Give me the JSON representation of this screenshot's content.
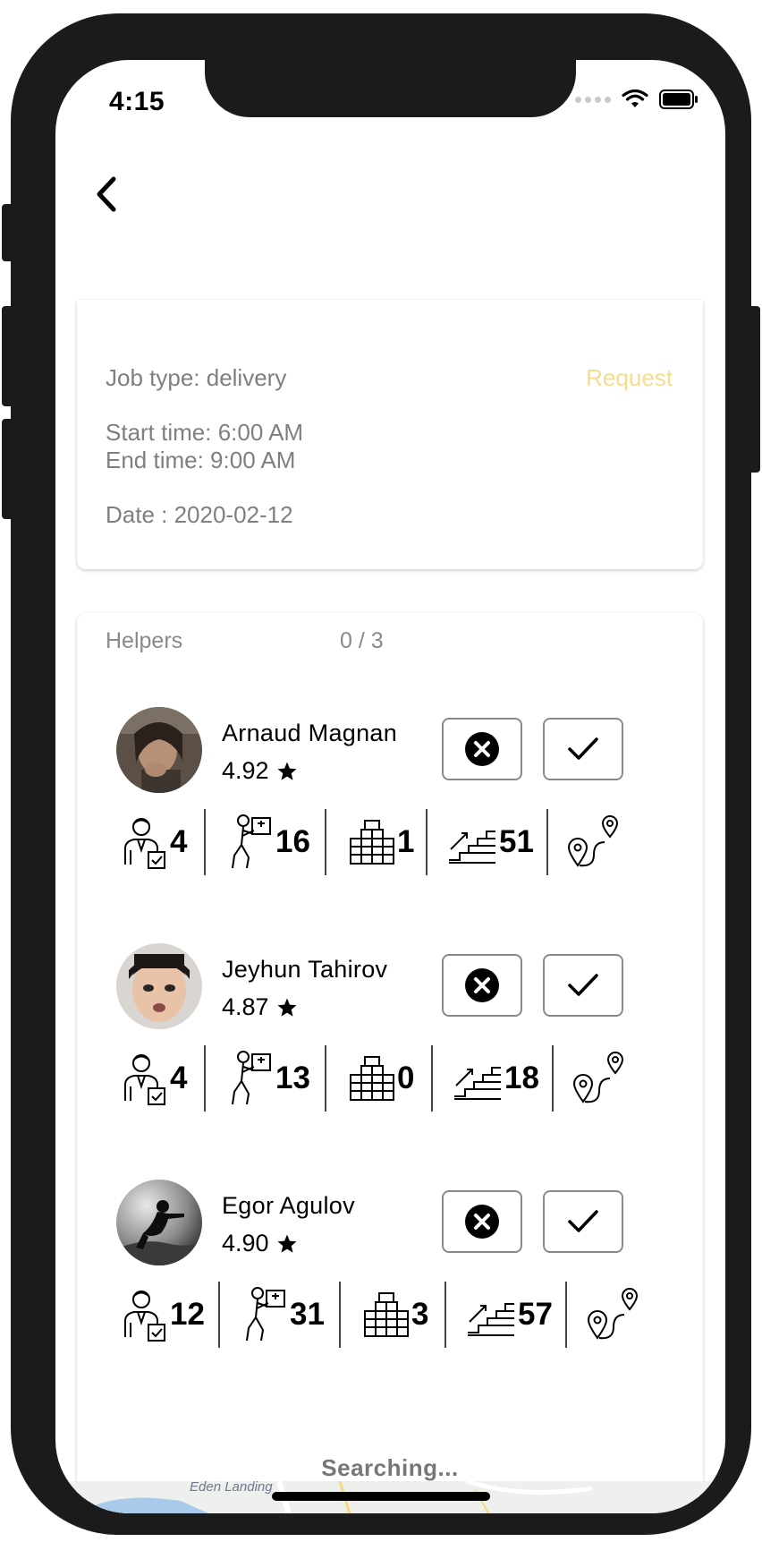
{
  "status_bar": {
    "time": "4:15"
  },
  "job": {
    "job_type": "Job type: delivery",
    "request_label": "Request",
    "start_time": "Start time: 6:00 AM",
    "end_time": "End time: 9:00 AM",
    "date": "Date : 2020-02-12"
  },
  "helpers_section": {
    "title": "Helpers",
    "count": "0 / 3",
    "status": "Searching..."
  },
  "helpers": [
    {
      "name": "Arnaud Magnan",
      "rating": "4.92",
      "stats": [
        "4",
        "16",
        "1",
        "51"
      ]
    },
    {
      "name": "Jeyhun Tahirov",
      "rating": "4.87",
      "stats": [
        "4",
        "13",
        "0",
        "18"
      ]
    },
    {
      "name": "Egor Agulov",
      "rating": "4.90",
      "stats": [
        "12",
        "31",
        "3",
        "57"
      ]
    }
  ],
  "map": {
    "label": "Eden Landing"
  },
  "icons": {
    "back": "chevron-left-icon",
    "reject": "close-circle-icon",
    "accept": "checkmark-icon",
    "rating": "star-icon",
    "stats": [
      "delivery-person-icon",
      "carrying-box-icon",
      "boxes-icon",
      "stairs-icon",
      "route-icon"
    ]
  },
  "colors": {
    "accent": "#f6dd8b",
    "muted_text": "#7f7f7f",
    "frame": "#1b1b1c"
  }
}
